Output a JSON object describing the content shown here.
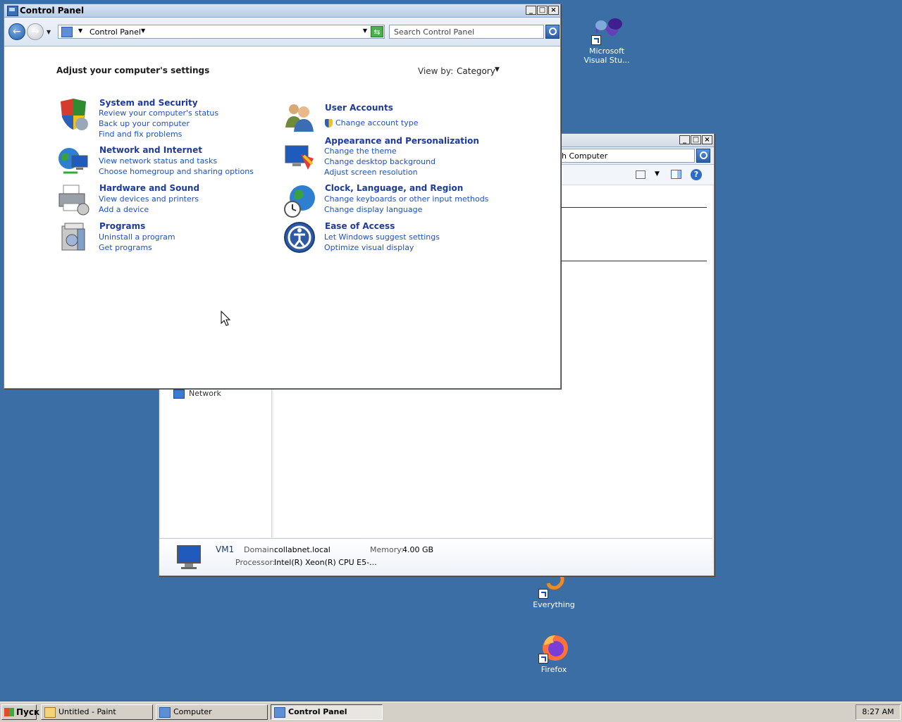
{
  "desktop": {
    "icons": [
      {
        "label_line1": "Microsoft",
        "label_line2": "Visual Stu..."
      },
      {
        "label_line1": "Everything",
        "label_line2": ""
      },
      {
        "label_line1": "Firefox",
        "label_line2": ""
      }
    ]
  },
  "computer_window": {
    "search_placeholder": "h Computer",
    "sidebar_item": "Network",
    "details": {
      "name": "VM1",
      "domain_label": "Domain:",
      "domain_value": "collabnet.local",
      "memory_label": "Memory:",
      "memory_value": "4.00 GB",
      "processor_label": "Processor:",
      "processor_value": "Intel(R) Xeon(R) CPU E5-..."
    }
  },
  "control_panel": {
    "title": "Control Panel",
    "breadcrumb": "Control Panel",
    "search_placeholder": "Search Control Panel",
    "heading": "Adjust your computer's settings",
    "view_by_label": "View by:",
    "view_by_value": "Category",
    "categories_left": [
      {
        "title": "System and Security",
        "links": [
          "Review your computer's status",
          "Back up your computer",
          "Find and fix problems"
        ]
      },
      {
        "title": "Network and Internet",
        "links": [
          "View network status and tasks",
          "Choose homegroup and sharing options"
        ]
      },
      {
        "title": "Hardware and Sound",
        "links": [
          "View devices and printers",
          "Add a device"
        ]
      },
      {
        "title": "Programs",
        "links": [
          "Uninstall a program",
          "Get programs"
        ]
      }
    ],
    "categories_right": [
      {
        "title": "User Accounts",
        "links": [
          "Change account type"
        ]
      },
      {
        "title": "Appearance and Personalization",
        "links": [
          "Change the theme",
          "Change desktop background",
          "Adjust screen resolution"
        ]
      },
      {
        "title": "Clock, Language, and Region",
        "links": [
          "Change keyboards or other input methods",
          "Change display language"
        ]
      },
      {
        "title": "Ease of Access",
        "links": [
          "Let Windows suggest settings",
          "Optimize visual display"
        ]
      }
    ]
  },
  "taskbar": {
    "start_label": "Пуск",
    "tasks": [
      "Untitled - Paint",
      "Computer",
      "Control Panel"
    ],
    "clock": "8:27 AM"
  }
}
